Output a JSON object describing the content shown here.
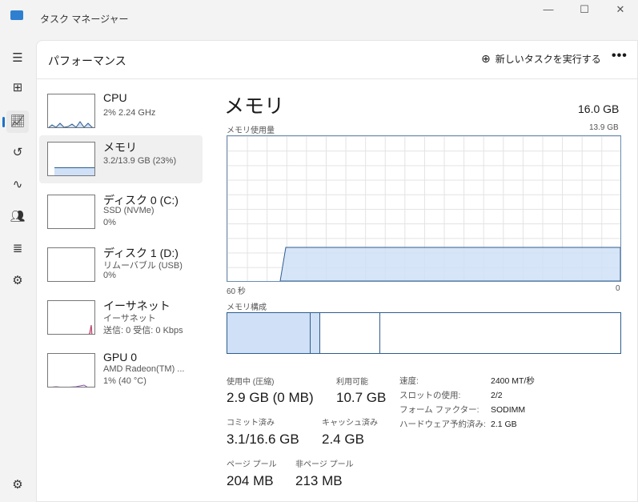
{
  "window": {
    "title": "タスク マネージャー",
    "minimize": "—",
    "maximize": "☐",
    "close": "✕"
  },
  "nav": [
    "menu-icon",
    "processes-icon",
    "performance-icon",
    "app-history-icon",
    "startup-icon",
    "users-icon",
    "details-icon",
    "services-icon",
    "settings-icon"
  ],
  "header": {
    "title": "パフォーマンス",
    "new_task": "新しいタスクを実行する",
    "more": "•••"
  },
  "sidebar": [
    {
      "name": "CPU",
      "sub1": "2%  2.24 GHz",
      "sub2": ""
    },
    {
      "name": "メモリ",
      "sub1": "3.2/13.9 GB (23%)",
      "sub2": ""
    },
    {
      "name": "ディスク 0 (C:)",
      "sub1": "SSD (NVMe)",
      "sub2": "0%"
    },
    {
      "name": "ディスク 1 (D:)",
      "sub1": "リムーバブル (USB)",
      "sub2": "0%"
    },
    {
      "name": "イーサネット",
      "sub1": "イーサネット",
      "sub2": "送信: 0 受信: 0 Kbps"
    },
    {
      "name": "GPU 0",
      "sub1": "AMD Radeon(TM) ...",
      "sub2": "1%  (40 °C)"
    }
  ],
  "detail": {
    "title": "メモリ",
    "total": "16.0 GB",
    "usage_label": "メモリ使用量",
    "usage_max": "13.9 GB",
    "time_left": "60 秒",
    "time_right": "0",
    "composition_label": "メモリ構成",
    "usage_fraction": 0.23,
    "stats": {
      "in_use_label": "使用中 (圧縮)",
      "in_use": "2.9 GB (0 MB)",
      "available_label": "利用可能",
      "available": "10.7 GB",
      "committed_label": "コミット済み",
      "committed": "3.1/16.6 GB",
      "cached_label": "キャッシュ済み",
      "cached": "2.4 GB",
      "paged_label": "ページ プール",
      "paged": "204 MB",
      "nonpaged_label": "非ページ プール",
      "nonpaged": "213 MB"
    },
    "props": [
      {
        "k": "速度:",
        "v": "2400 MT/秒"
      },
      {
        "k": "スロットの使用:",
        "v": "2/2"
      },
      {
        "k": "フォーム ファクター:",
        "v": "SODIMM"
      },
      {
        "k": "ハードウェア予約済み:",
        "v": "2.1 GB"
      }
    ]
  },
  "colors": {
    "memory": "#cfe0f7",
    "memory_line": "#2f5d8c"
  }
}
